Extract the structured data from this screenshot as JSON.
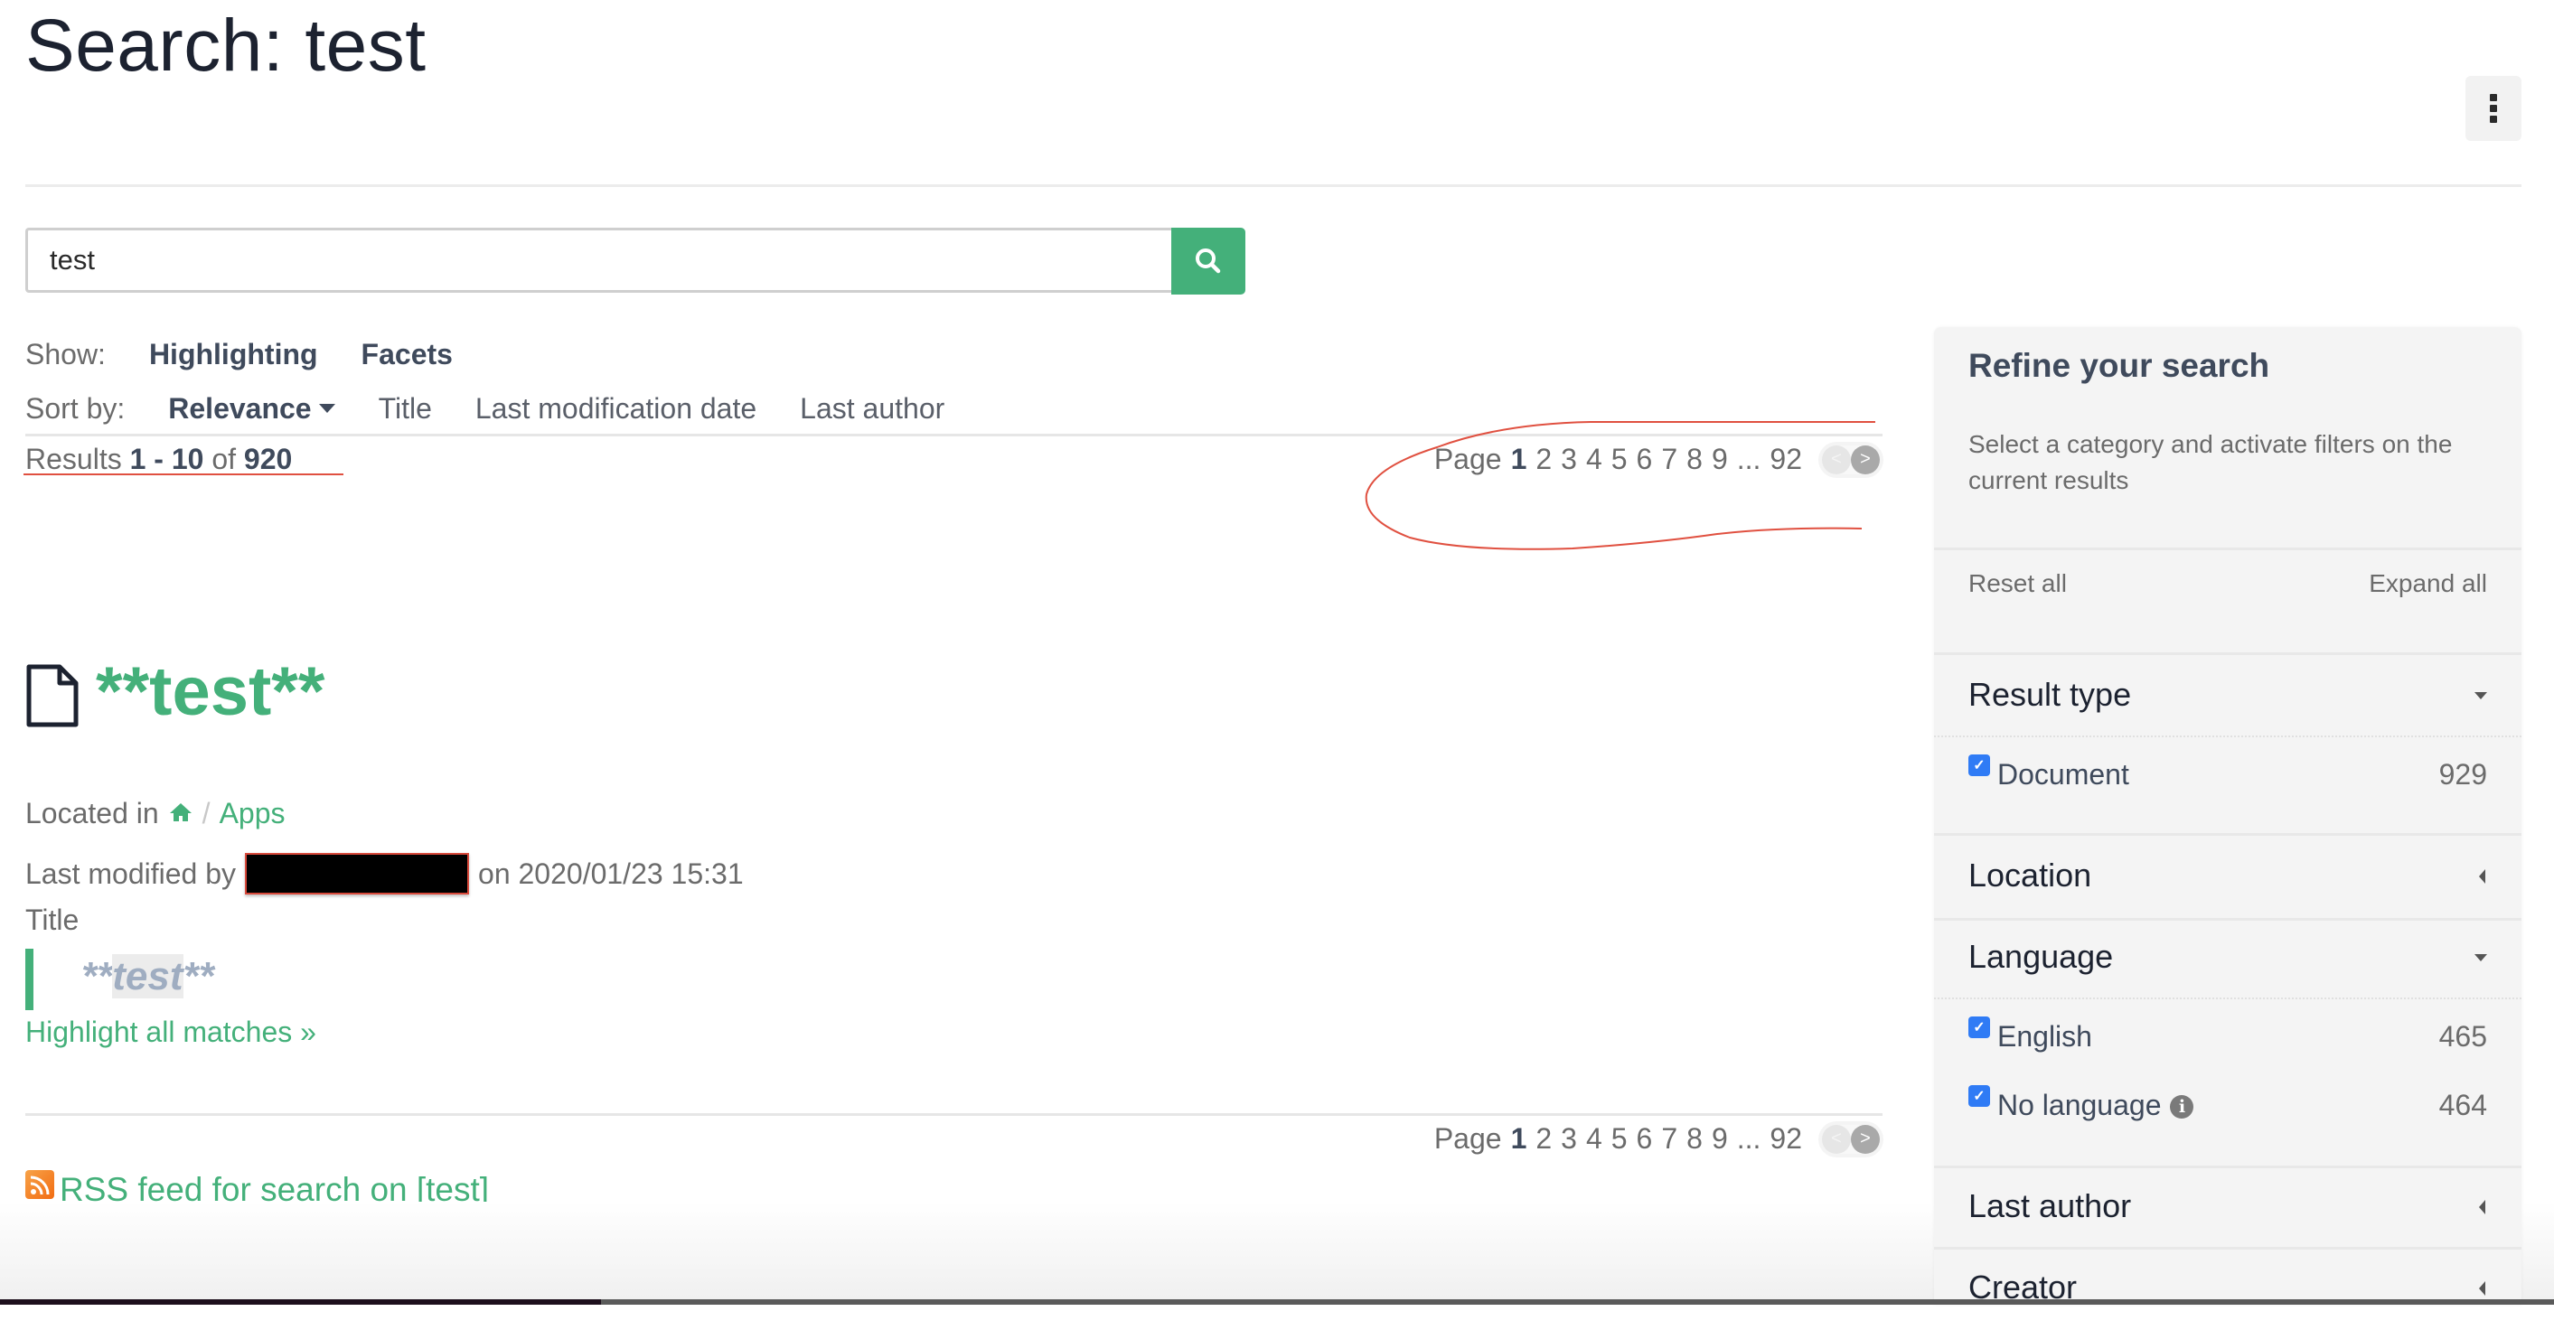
{
  "page": {
    "title": "Search: test",
    "menu_icon": "vertical-ellipsis-icon"
  },
  "search": {
    "value": "test",
    "placeholder": "",
    "button_icon": "search-icon"
  },
  "show": {
    "label": "Show:",
    "options": [
      "Highlighting",
      "Facets"
    ]
  },
  "sort": {
    "label": "Sort by:",
    "active": "Relevance",
    "options": [
      "Title",
      "Last modification date",
      "Last author"
    ]
  },
  "results": {
    "prefix": "Results",
    "range": "1 - 10",
    "of": "of",
    "total": "920"
  },
  "pagination": {
    "label": "Page",
    "current": "1",
    "pages": [
      "2",
      "3",
      "4",
      "5",
      "6",
      "7",
      "8",
      "9"
    ],
    "ellipsis": "...",
    "last": "92",
    "prev": "<",
    "next": ">"
  },
  "result": {
    "icon": "file-icon",
    "title": "**test**",
    "located_label": "Located in",
    "location_home_icon": "home-icon",
    "location_separator": "/",
    "location_path": "Apps",
    "modified_label": "Last modified by",
    "modified_author": "[redacted]",
    "modified_on": "on 2020/01/23 15:31",
    "field_label": "Title",
    "snippet_prefix": "**",
    "snippet_match": "test",
    "snippet_suffix": "**",
    "highlight_all": "Highlight all matches »"
  },
  "rss": {
    "icon": "rss-icon",
    "label": "RSS feed for search on [test]"
  },
  "sidebar": {
    "title": "Refine your search",
    "hint": "Select a category and activate filters on the current results",
    "reset_all": "Reset all",
    "expand_all": "Expand all",
    "facets": [
      {
        "name": "Result type",
        "expanded": true,
        "items": [
          {
            "label": "Document",
            "count": "929",
            "checked": true
          }
        ]
      },
      {
        "name": "Location",
        "expanded": false
      },
      {
        "name": "Language",
        "expanded": true,
        "items": [
          {
            "label": "English",
            "count": "465",
            "checked": true
          },
          {
            "label": "No language",
            "count": "464",
            "checked": true,
            "info_icon": "info-icon"
          }
        ]
      },
      {
        "name": "Last author",
        "expanded": false
      },
      {
        "name": "Creator",
        "expanded": false
      }
    ]
  },
  "colors": {
    "accent": "#44b07a",
    "heading": "#3f4a5c",
    "muted": "#6b6b6b",
    "checkbox": "#2f7bf5",
    "sidebar_bg": "#f4f4f4",
    "annotation": "#e05040"
  }
}
